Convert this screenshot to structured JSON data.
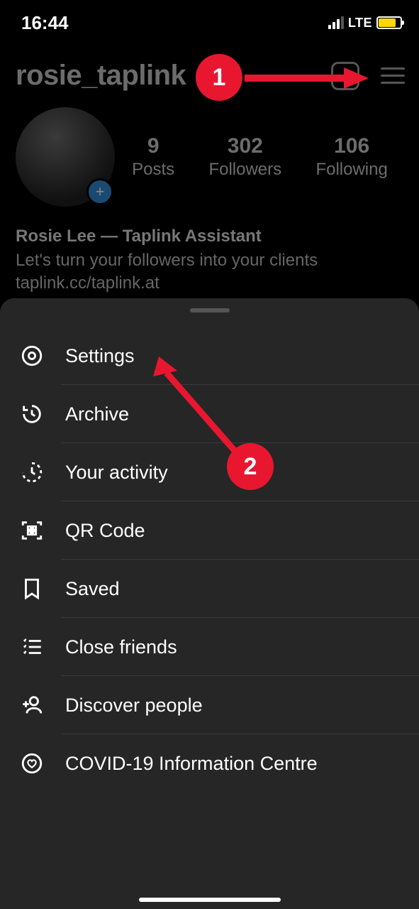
{
  "status": {
    "time": "16:44",
    "network": "LTE"
  },
  "profile": {
    "username": "rosie_taplink",
    "stats": {
      "posts_count": "9",
      "posts_label": "Posts",
      "followers_count": "302",
      "followers_label": "Followers",
      "following_count": "106",
      "following_label": "Following"
    },
    "display_name": "Rosie Lee — Taplink Assistant",
    "bio_text": "Let's turn your followers into your clients",
    "link": "taplink.cc/taplink.at"
  },
  "menu": {
    "settings": "Settings",
    "archive": "Archive",
    "activity": "Your activity",
    "qr": "QR Code",
    "saved": "Saved",
    "close_friends": "Close friends",
    "discover": "Discover people",
    "covid": "COVID-19 Information Centre"
  },
  "annotations": {
    "step1": "1",
    "step2": "2"
  }
}
